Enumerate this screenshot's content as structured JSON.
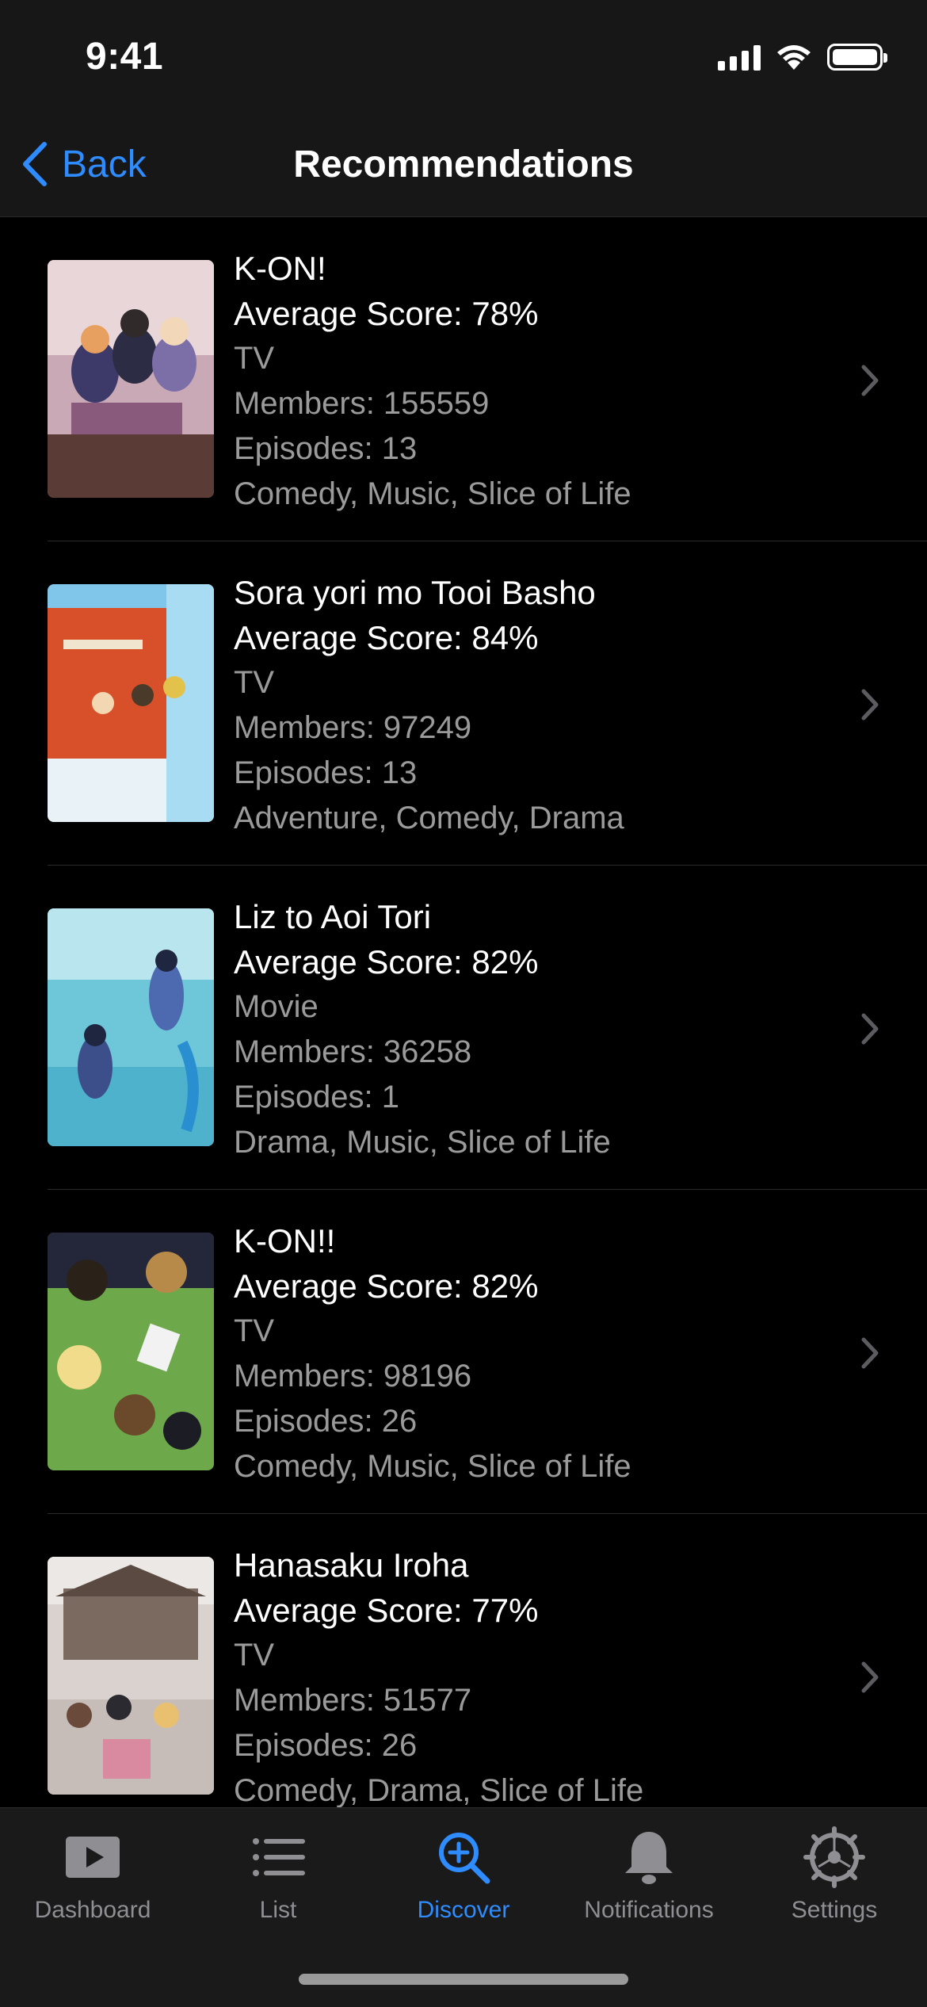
{
  "status_bar": {
    "time": "9:41"
  },
  "nav": {
    "back_label": "Back",
    "title": "Recommendations"
  },
  "recommendations": [
    {
      "title": "K-ON!",
      "score": "Average Score: 78%",
      "format": "TV",
      "members": "Members: 155559",
      "episodes": "Episodes: 13",
      "genres": "Comedy, Music, Slice of Life"
    },
    {
      "title": "Sora yori mo Tooi Basho",
      "score": "Average Score: 84%",
      "format": "TV",
      "members": "Members: 97249",
      "episodes": "Episodes: 13",
      "genres": "Adventure, Comedy, Drama"
    },
    {
      "title": "Liz to Aoi Tori",
      "score": "Average Score: 82%",
      "format": "Movie",
      "members": "Members: 36258",
      "episodes": "Episodes: 1",
      "genres": "Drama, Music, Slice of Life"
    },
    {
      "title": "K-ON!!",
      "score": "Average Score: 82%",
      "format": "TV",
      "members": "Members: 98196",
      "episodes": "Episodes: 26",
      "genres": "Comedy, Music, Slice of Life"
    },
    {
      "title": "Hanasaku Iroha",
      "score": "Average Score: 77%",
      "format": "TV",
      "members": "Members: 51577",
      "episodes": "Episodes: 26",
      "genres": "Comedy, Drama, Slice of Life"
    }
  ],
  "tabs": [
    {
      "label": "Dashboard",
      "icon": "play-icon",
      "active": false
    },
    {
      "label": "List",
      "icon": "list-icon",
      "active": false
    },
    {
      "label": "Discover",
      "icon": "magnify-plus-icon",
      "active": true
    },
    {
      "label": "Notifications",
      "icon": "bell-icon",
      "active": false
    },
    {
      "label": "Settings",
      "icon": "gear-icon",
      "active": false
    }
  ],
  "colors": {
    "accent": "#2f8cff",
    "secondary_text": "#9a9a9a",
    "bar_bg": "#171717",
    "inactive_tab": "#8e8e93"
  }
}
